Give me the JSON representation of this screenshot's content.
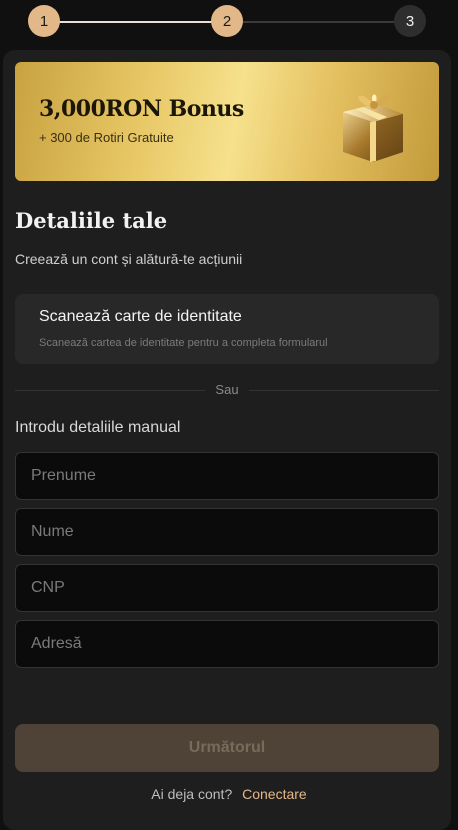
{
  "stepper": {
    "steps": [
      "1",
      "2",
      "3"
    ],
    "current": 2
  },
  "banner": {
    "title": "3,000RON Bonus",
    "subtitle": "+ 300 de Rotiri Gratuite",
    "image": "gift-box"
  },
  "form": {
    "title": "Detaliile tale",
    "subtitle": "Creează un cont și alătură-te acțiunii",
    "scan": {
      "title": "Scanează carte de identitate",
      "description": "Scanează cartea de identitate pentru a completa formularul"
    },
    "divider_label": "Sau",
    "manual_label": "Introdu detaliile manual",
    "fields": {
      "first_name": {
        "placeholder": "Prenume",
        "value": ""
      },
      "last_name": {
        "placeholder": "Nume",
        "value": ""
      },
      "cnp": {
        "placeholder": "CNP",
        "value": ""
      },
      "address": {
        "placeholder": "Adresă",
        "value": ""
      }
    },
    "next_label": "Următorul",
    "login_question": "Ai deja cont?",
    "login_link": "Conectare"
  },
  "colors": {
    "accent": "#e3b888",
    "background": "#101010",
    "card": "#1e1e1e",
    "button_disabled": "#4e4336"
  }
}
